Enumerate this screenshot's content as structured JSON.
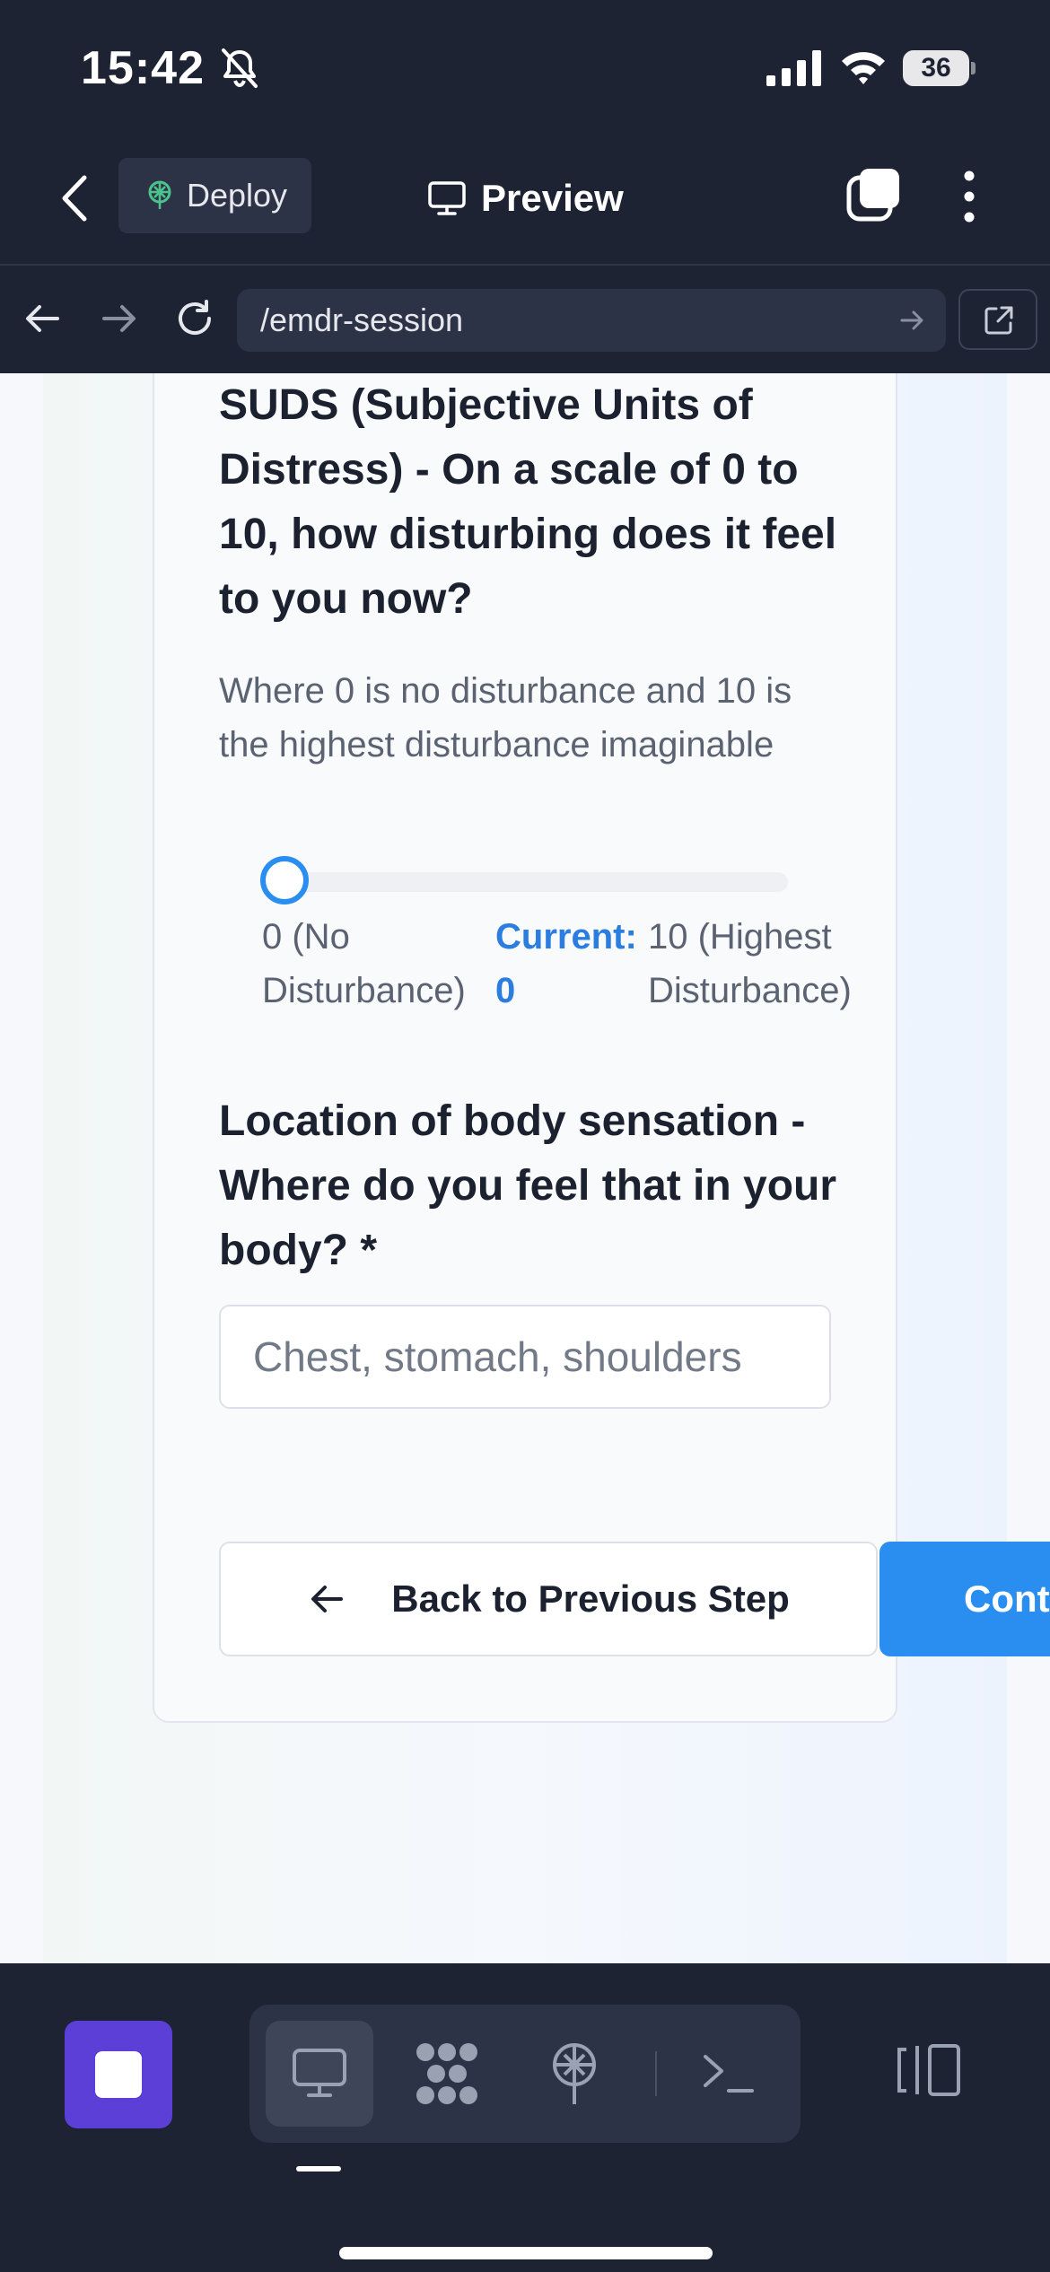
{
  "status_bar": {
    "time": "15:42",
    "battery": "36"
  },
  "app_bar": {
    "deploy_label": "Deploy",
    "preview_label": "Preview"
  },
  "browser": {
    "url": "/emdr-session"
  },
  "form": {
    "suds_question": "SUDS (Subjective Units of Distress) - On a scale of 0 to 10, how disturbing does it feel to you now?",
    "suds_hint": "Where 0 is no disturbance and 10 is the highest disturbance imaginable",
    "slider": {
      "min_label": "0 (No Disturbance)",
      "current_label": "Current: 0",
      "max_label": "10 (Highest Disturbance)",
      "min": 0,
      "max": 10,
      "value": 0
    },
    "location_question": "Location of body sensation - Where do you feel that in your body? *",
    "location_placeholder": "Chest, stomach, shoulders",
    "location_value": "",
    "back_button_label": "Back to Previous Step",
    "continue_button_label": "Continue"
  },
  "colors": {
    "accent": "#2a8ef0",
    "stop_button": "#5b3fd6",
    "chrome": "#1e2334"
  },
  "icons": {
    "status": [
      "bell-slash-icon",
      "cellular-signal-icon",
      "wifi-icon",
      "battery-icon"
    ],
    "app_bar": [
      "chevron-left-icon",
      "deploy-icon",
      "monitor-icon",
      "tabs-icon",
      "more-vertical-icon"
    ],
    "browser": [
      "arrow-left-icon",
      "arrow-right-icon",
      "reload-icon",
      "arrow-right-small-icon",
      "external-link-icon"
    ],
    "dock": [
      "stop-icon",
      "monitor-icon",
      "agents-icon",
      "deploy-icon",
      "terminal-icon",
      "panel-toggle-icon"
    ]
  }
}
